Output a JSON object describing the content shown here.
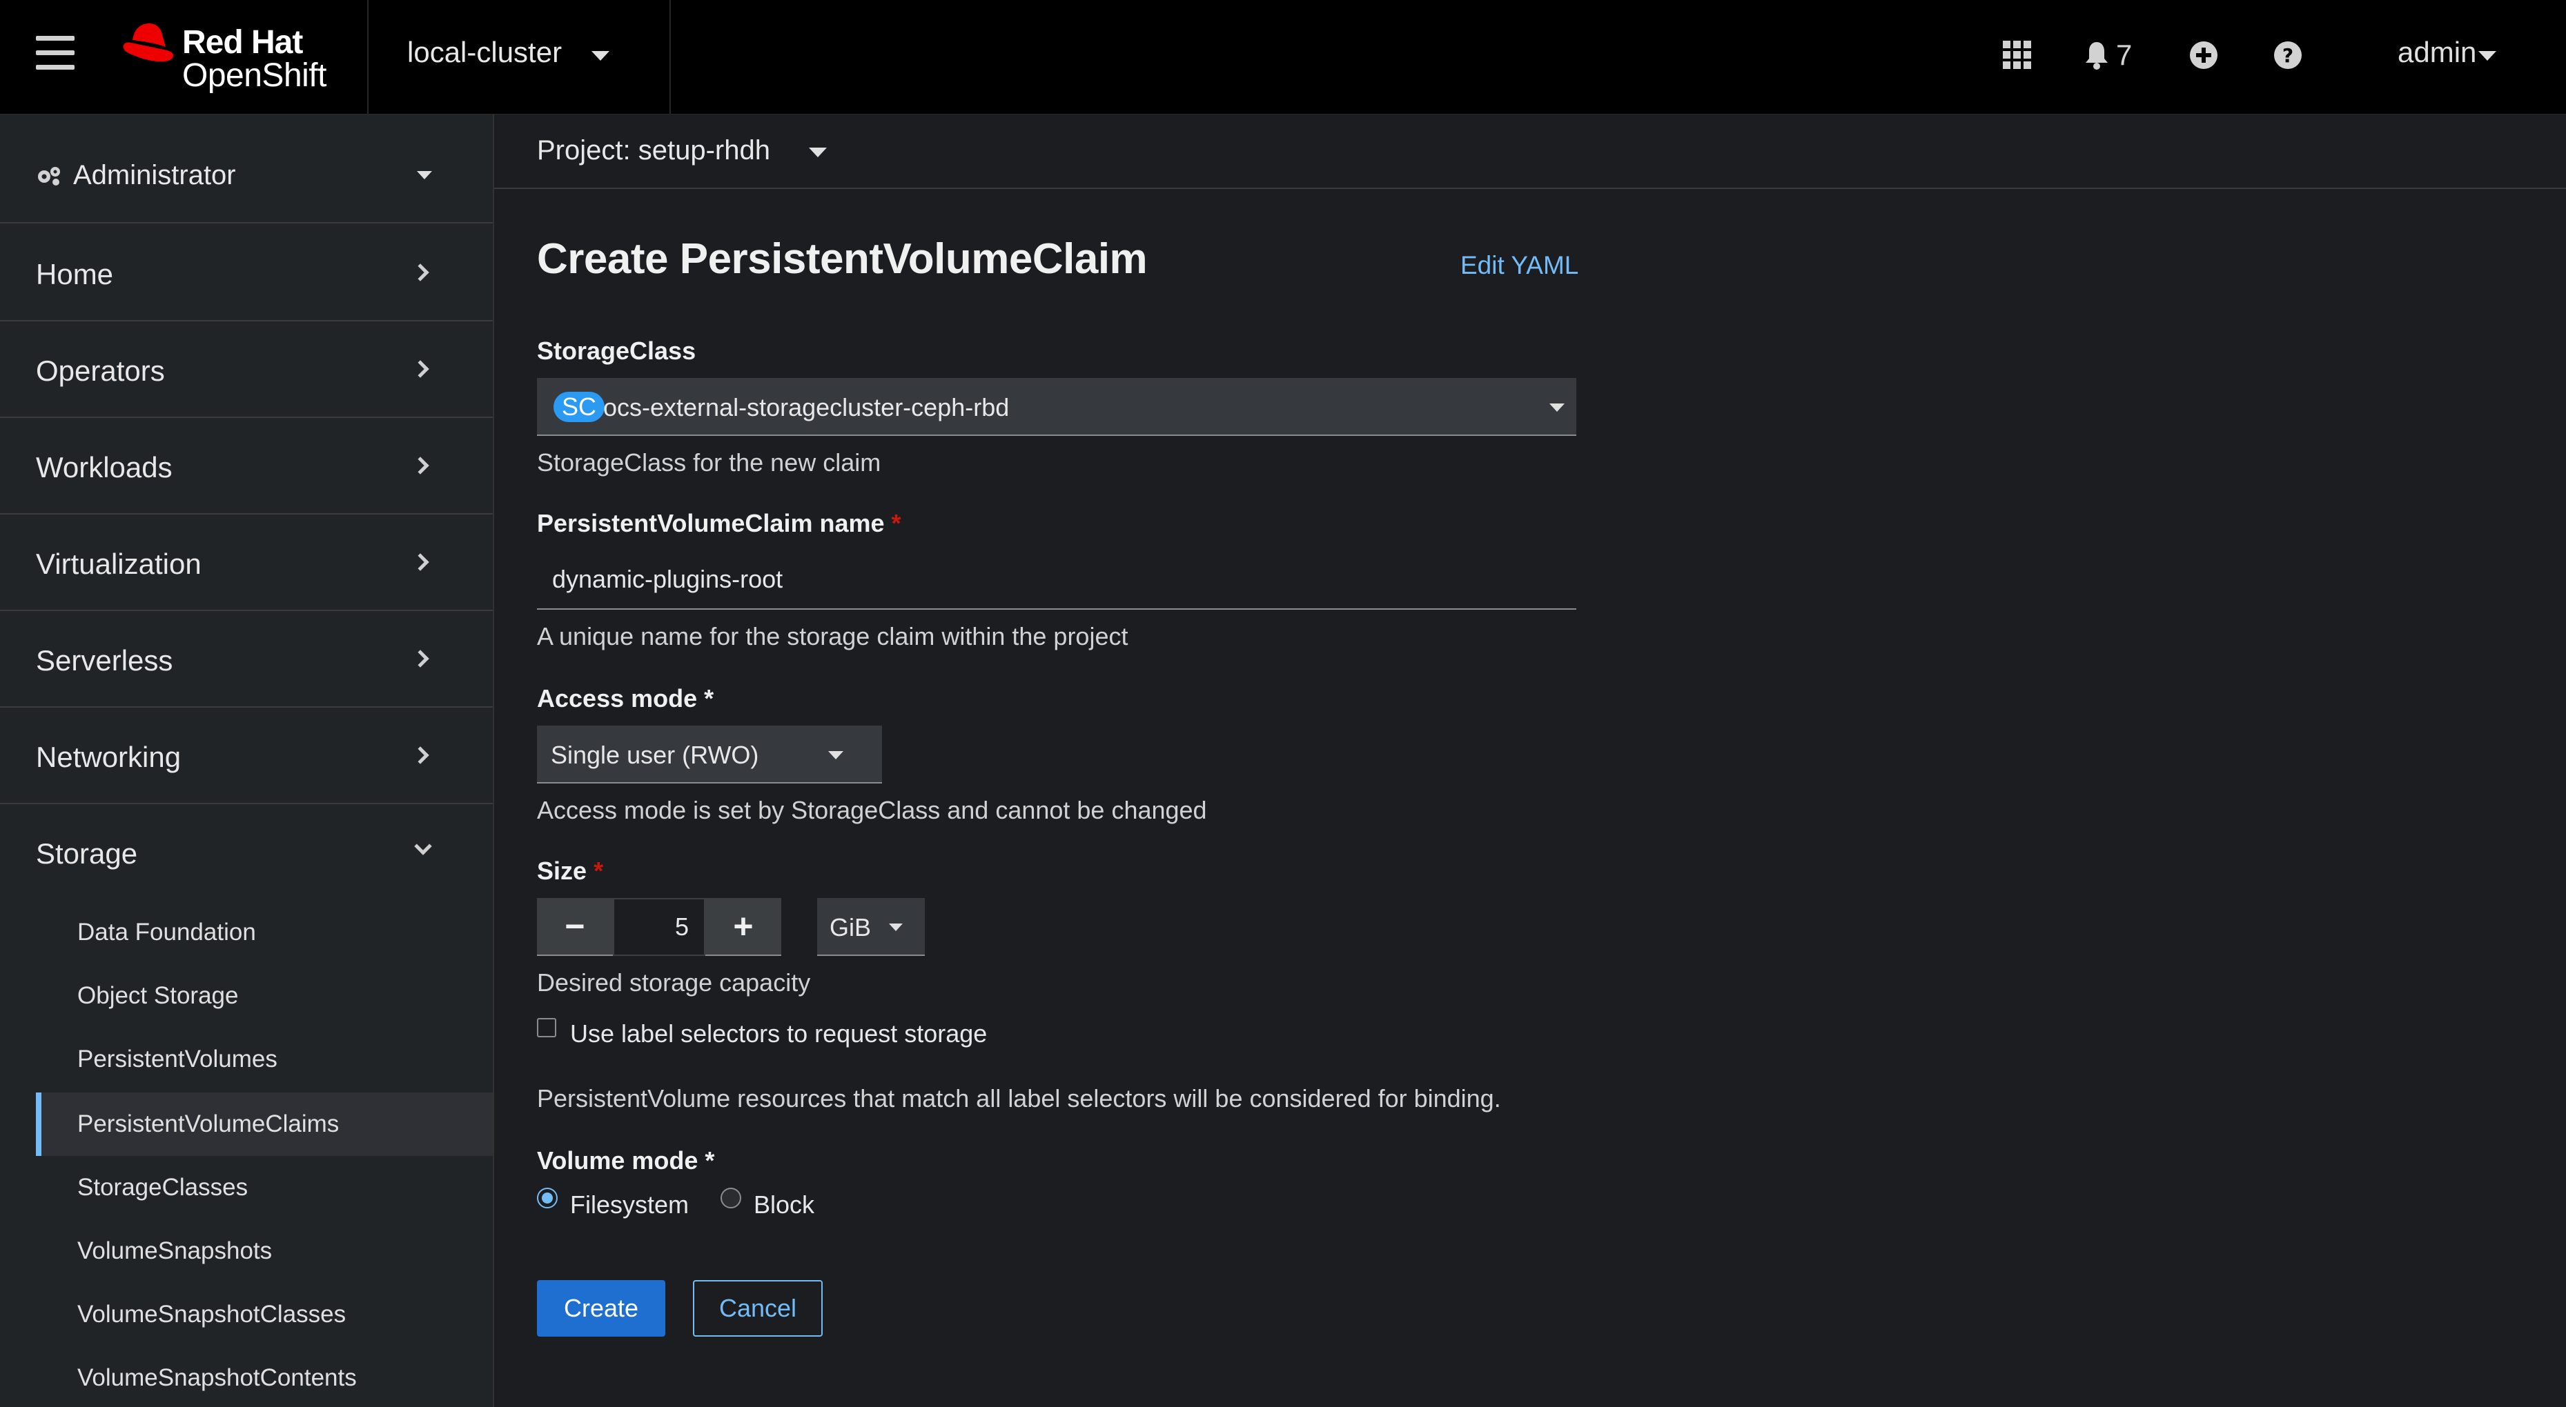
{
  "masthead": {
    "brand_line1": "Red Hat",
    "brand_line2": "OpenShift",
    "cluster": "local-cluster",
    "notification_count": "7",
    "user": "admin",
    "icons": [
      "menu-icon",
      "apps-grid-icon",
      "bell-icon",
      "plus-circle-icon",
      "help-icon"
    ]
  },
  "sidebar": {
    "perspective": "Administrator",
    "items": [
      {
        "label": "Home"
      },
      {
        "label": "Operators"
      },
      {
        "label": "Workloads"
      },
      {
        "label": "Virtualization"
      },
      {
        "label": "Serverless"
      },
      {
        "label": "Networking"
      }
    ],
    "storage": {
      "label": "Storage",
      "expanded": true,
      "children": [
        {
          "label": "Data Foundation"
        },
        {
          "label": "Object Storage"
        },
        {
          "label": "PersistentVolumes"
        },
        {
          "label": "PersistentVolumeClaims",
          "active": true
        },
        {
          "label": "StorageClasses"
        },
        {
          "label": "VolumeSnapshots"
        },
        {
          "label": "VolumeSnapshotClasses"
        },
        {
          "label": "VolumeSnapshotContents"
        }
      ]
    }
  },
  "project": {
    "label": "Project: setup-rhdh"
  },
  "form": {
    "title": "Create PersistentVolumeClaim",
    "edit_yaml": "Edit YAML",
    "storage_class": {
      "label": "StorageClass",
      "badge": "SC",
      "value": "ocs-external-storagecluster-ceph-rbd",
      "help": "StorageClass for the new claim"
    },
    "pvc_name": {
      "label": "PersistentVolumeClaim name",
      "required_mark": "*",
      "value": "dynamic-plugins-root",
      "help": "A unique name for the storage claim within the project"
    },
    "access_mode": {
      "label": "Access mode",
      "required_mark": "*",
      "value": "Single user (RWO)",
      "help": "Access mode is set by StorageClass and cannot be changed"
    },
    "size": {
      "label": "Size",
      "required_mark": "*",
      "value": "5",
      "minus": "−",
      "plus": "+",
      "unit": "GiB",
      "help": "Desired storage capacity"
    },
    "label_selectors": {
      "label": "Use label selectors to request storage",
      "checked": false,
      "help": "PersistentVolume resources that match all label selectors will be considered for binding."
    },
    "volume_mode": {
      "label": "Volume mode",
      "required_mark": "*",
      "options": [
        "Filesystem",
        "Block"
      ],
      "selected": "Filesystem"
    },
    "create_label": "Create",
    "cancel_label": "Cancel"
  },
  "colors": {
    "accent": "#73bcf7",
    "primary_button": "#1f6fd0",
    "required": "#c9190b",
    "logo_red": "#ee0000"
  }
}
